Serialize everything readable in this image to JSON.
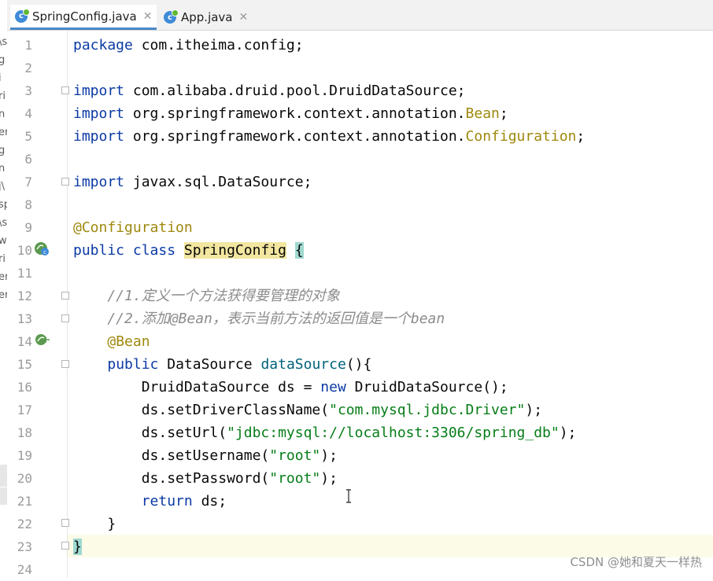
{
  "tabs": [
    {
      "label": "SpringConfig.java",
      "active": true
    },
    {
      "label": "App.java",
      "active": false
    }
  ],
  "left_strip_chars": [
    "\\s",
    "g",
    "i",
    "ri",
    "n",
    "er",
    "g",
    "n",
    "j\\",
    "sp",
    "\\s",
    "w",
    "ri",
    "er",
    "er"
  ],
  "code_lines": [
    {
      "num": "1",
      "segments": [
        {
          "t": "package",
          "c": "kw"
        },
        {
          "t": " com.itheima.config;",
          "c": ""
        }
      ]
    },
    {
      "num": "2",
      "segments": []
    },
    {
      "num": "3",
      "segments": [
        {
          "t": "import",
          "c": "kw"
        },
        {
          "t": " com.alibaba.druid.pool.DruidDataSource;",
          "c": ""
        }
      ]
    },
    {
      "num": "4",
      "segments": [
        {
          "t": "import",
          "c": "kw"
        },
        {
          "t": " org.springframework.context.annotation.",
          "c": ""
        },
        {
          "t": "Bean",
          "c": "ann"
        },
        {
          "t": ";",
          "c": ""
        }
      ]
    },
    {
      "num": "5",
      "segments": [
        {
          "t": "import",
          "c": "kw"
        },
        {
          "t": " org.springframework.context.annotation.",
          "c": ""
        },
        {
          "t": "Configuration",
          "c": "ann"
        },
        {
          "t": ";",
          "c": ""
        }
      ]
    },
    {
      "num": "6",
      "segments": []
    },
    {
      "num": "7",
      "segments": [
        {
          "t": "import",
          "c": "kw"
        },
        {
          "t": " javax.sql.DataSource;",
          "c": ""
        }
      ]
    },
    {
      "num": "8",
      "segments": []
    },
    {
      "num": "9",
      "segments": [
        {
          "t": "@Configuration",
          "c": "ann"
        }
      ]
    },
    {
      "num": "10",
      "segments": [
        {
          "t": "public",
          "c": "kw"
        },
        {
          "t": " ",
          "c": ""
        },
        {
          "t": "class",
          "c": "kw"
        },
        {
          "t": " ",
          "c": ""
        },
        {
          "t": "SpringConfig",
          "c": "hl-name"
        },
        {
          "t": " ",
          "c": ""
        },
        {
          "t": "{",
          "c": "brace-hl"
        }
      ]
    },
    {
      "num": "11",
      "segments": []
    },
    {
      "num": "12",
      "segments": [
        {
          "t": "    //1.定义一个方法获得要管理的对象",
          "c": "cmt"
        }
      ]
    },
    {
      "num": "13",
      "segments": [
        {
          "t": "    //2.添加@Bean，表示当前方法的返回值是一个bean",
          "c": "cmt"
        }
      ]
    },
    {
      "num": "14",
      "segments": [
        {
          "t": "    ",
          "c": ""
        },
        {
          "t": "@Bean",
          "c": "ann"
        }
      ]
    },
    {
      "num": "15",
      "segments": [
        {
          "t": "    ",
          "c": ""
        },
        {
          "t": "public",
          "c": "kw"
        },
        {
          "t": " DataSource ",
          "c": ""
        },
        {
          "t": "dataSource",
          "c": "method"
        },
        {
          "t": "(){",
          "c": ""
        }
      ]
    },
    {
      "num": "16",
      "segments": [
        {
          "t": "        DruidDataSource ds = ",
          "c": ""
        },
        {
          "t": "new",
          "c": "kw"
        },
        {
          "t": " DruidDataSource();",
          "c": ""
        }
      ]
    },
    {
      "num": "17",
      "segments": [
        {
          "t": "        ds.setDriverClassName(",
          "c": ""
        },
        {
          "t": "\"com.mysql.jdbc.Driver\"",
          "c": "str"
        },
        {
          "t": ");",
          "c": ""
        }
      ]
    },
    {
      "num": "18",
      "segments": [
        {
          "t": "        ds.setUrl(",
          "c": ""
        },
        {
          "t": "\"jdbc:mysql://localhost:3306/spring_db\"",
          "c": "str"
        },
        {
          "t": ");",
          "c": ""
        }
      ]
    },
    {
      "num": "19",
      "segments": [
        {
          "t": "        ds.setUsername(",
          "c": ""
        },
        {
          "t": "\"root\"",
          "c": "str"
        },
        {
          "t": ");",
          "c": ""
        }
      ]
    },
    {
      "num": "20",
      "segments": [
        {
          "t": "        ds.setPassword(",
          "c": ""
        },
        {
          "t": "\"root\"",
          "c": "str"
        },
        {
          "t": ");",
          "c": ""
        }
      ]
    },
    {
      "num": "21",
      "segments": [
        {
          "t": "        ",
          "c": ""
        },
        {
          "t": "return",
          "c": "kw"
        },
        {
          "t": " ds;",
          "c": ""
        }
      ]
    },
    {
      "num": "22",
      "segments": [
        {
          "t": "    }",
          "c": ""
        }
      ]
    },
    {
      "num": "23",
      "segments": [
        {
          "t": "}",
          "c": "brace-hl"
        }
      ]
    },
    {
      "num": "24",
      "segments": []
    }
  ],
  "watermark": "CSDN @她和夏天一样热",
  "colors": {
    "keyword": "#0b3aa5",
    "annotation": "#9e880d",
    "string": "#067d17",
    "comment": "#8c8c8c",
    "method": "#00627a",
    "brace_match": "#9fd9d0",
    "tab_underline": "#4a88c7"
  },
  "icons": {
    "tab_class": "java-class-icon",
    "line10": "bean-class-icon",
    "line14": "bean-method-icon"
  }
}
